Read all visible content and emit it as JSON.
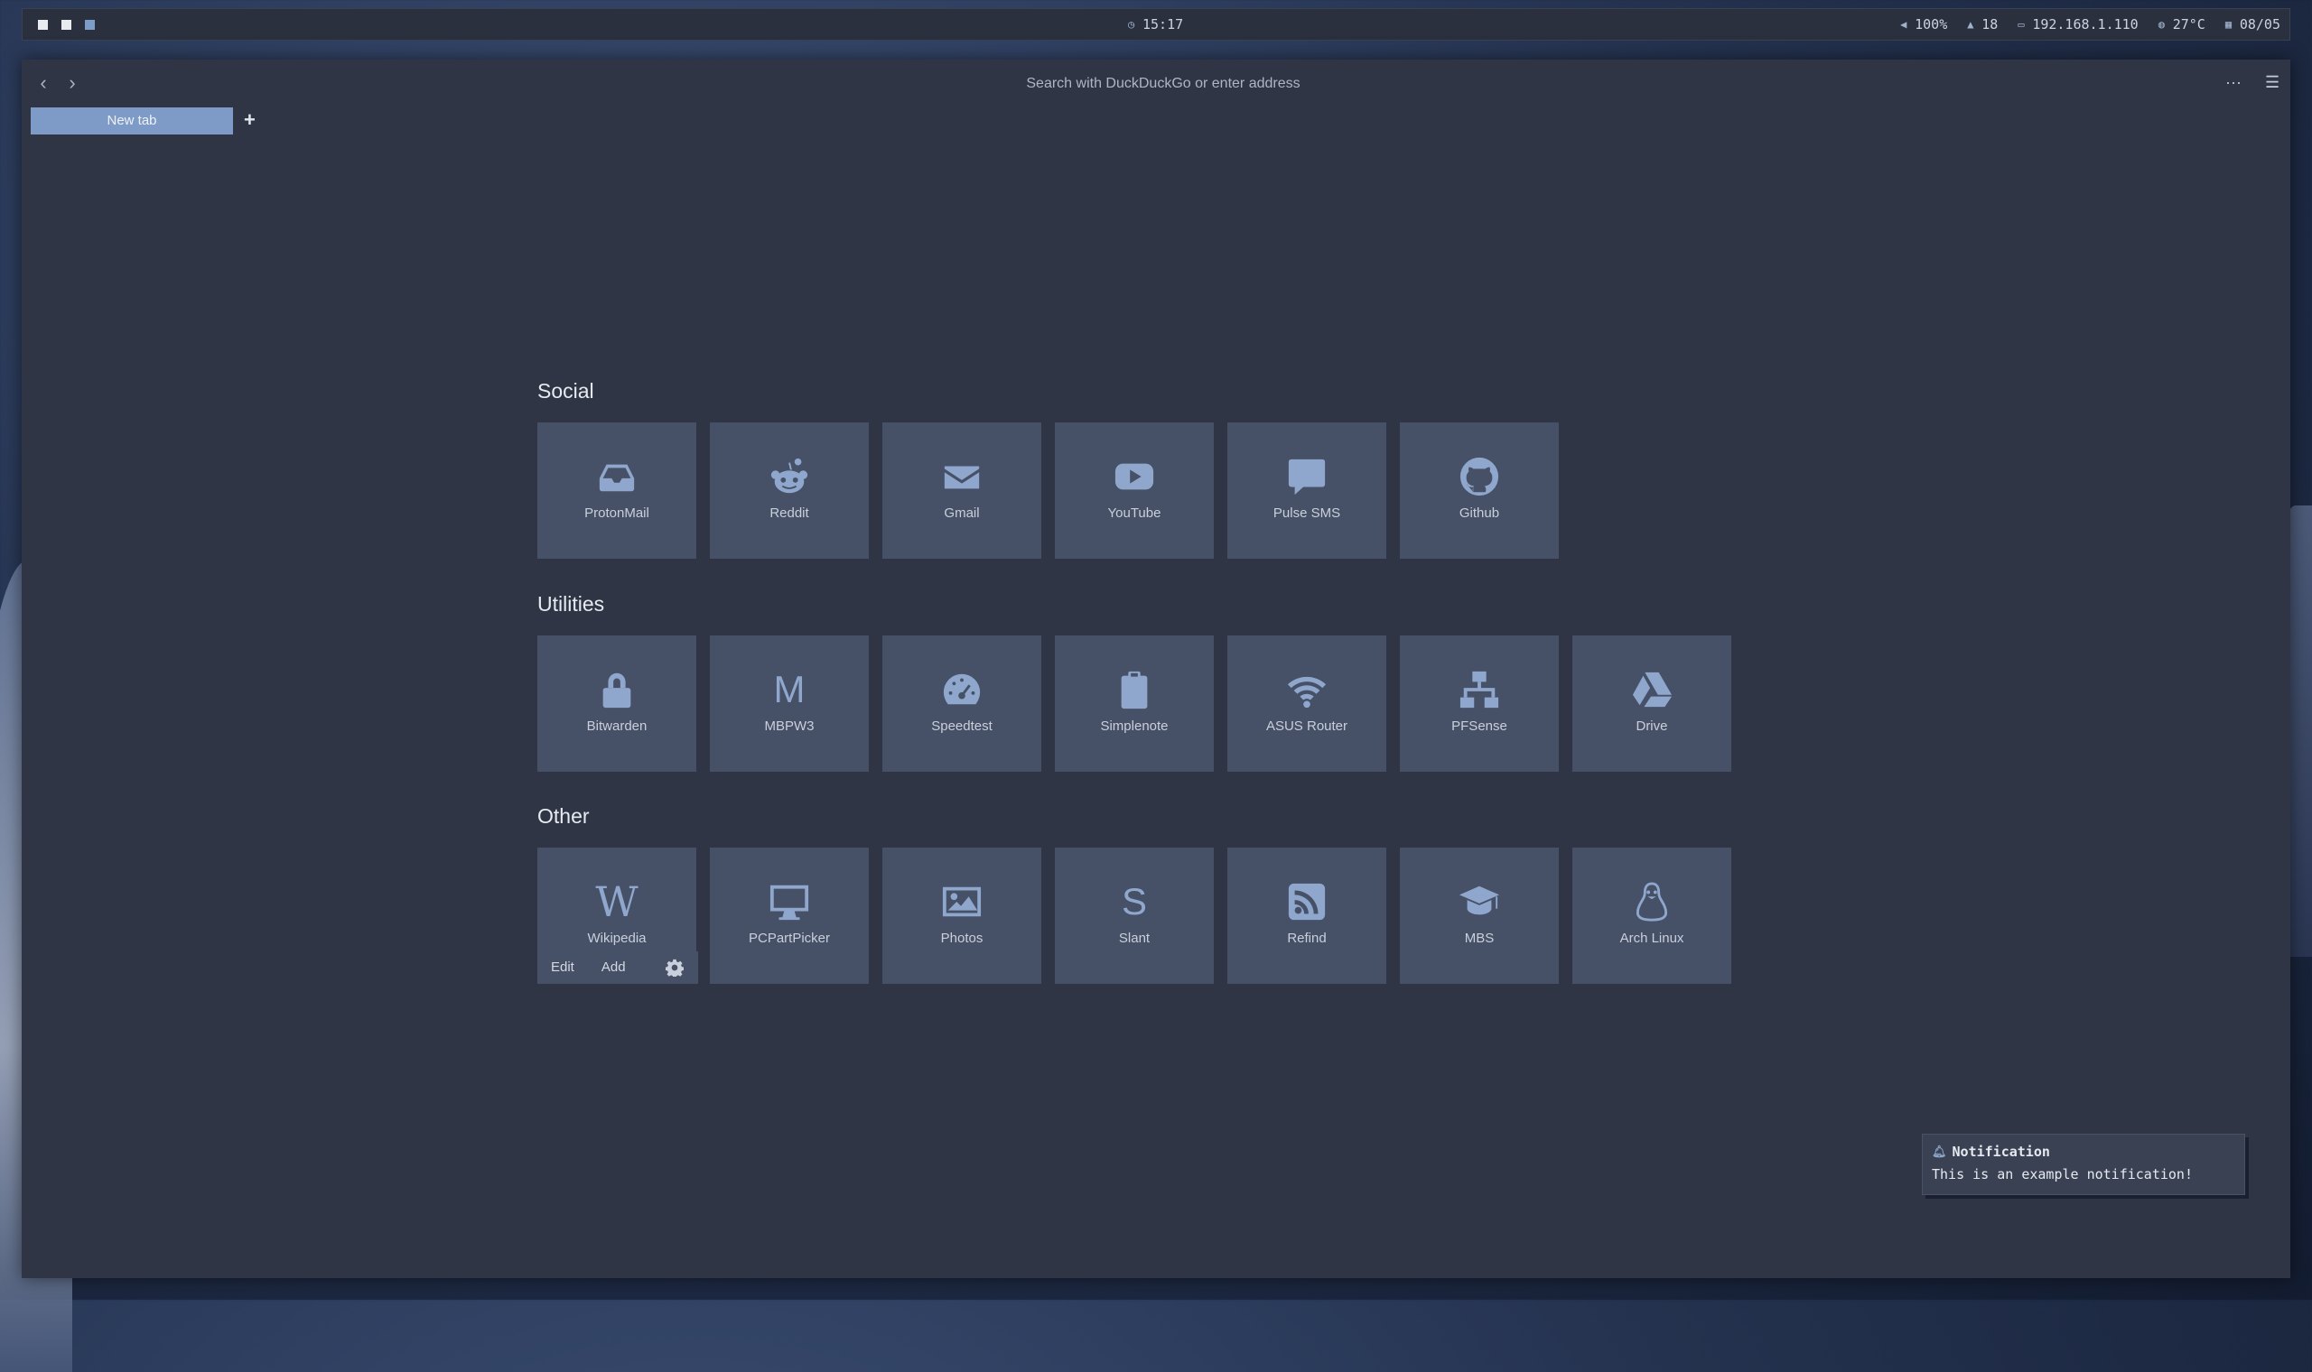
{
  "topbar": {
    "workspaces": [
      "1",
      "2",
      "3"
    ],
    "clock": "15:17",
    "volume": "100%",
    "updates": "18",
    "ip": "192.168.1.110",
    "temp": "27°C",
    "date": "08/05"
  },
  "browser": {
    "address_placeholder": "Search with DuckDuckGo or enter address",
    "tab_label": "New tab",
    "new_tab_symbol": "+"
  },
  "sections": [
    {
      "title": "Social",
      "items": [
        {
          "label": "ProtonMail",
          "icon": "inbox-icon"
        },
        {
          "label": "Reddit",
          "icon": "reddit-icon"
        },
        {
          "label": "Gmail",
          "icon": "envelope-icon"
        },
        {
          "label": "YouTube",
          "icon": "youtube-icon"
        },
        {
          "label": "Pulse SMS",
          "icon": "chat-bubble-icon"
        },
        {
          "label": "Github",
          "icon": "github-icon"
        }
      ]
    },
    {
      "title": "Utilities",
      "items": [
        {
          "label": "Bitwarden",
          "icon": "lock-icon"
        },
        {
          "label": "MBPW3",
          "icon": "letter-m-icon"
        },
        {
          "label": "Speedtest",
          "icon": "speedometer-icon"
        },
        {
          "label": "Simplenote",
          "icon": "clipboard-icon"
        },
        {
          "label": "ASUS Router",
          "icon": "wifi-icon"
        },
        {
          "label": "PFSense",
          "icon": "network-icon"
        },
        {
          "label": "Drive",
          "icon": "google-drive-icon"
        }
      ]
    },
    {
      "title": "Other",
      "items": [
        {
          "label": "Wikipedia",
          "icon": "wikipedia-icon"
        },
        {
          "label": "PCPartPicker",
          "icon": "desktop-icon"
        },
        {
          "label": "Photos",
          "icon": "image-icon"
        },
        {
          "label": "Slant",
          "icon": "letter-s-icon"
        },
        {
          "label": "Refind",
          "icon": "rss-icon"
        },
        {
          "label": "MBS",
          "icon": "graduation-cap-icon"
        },
        {
          "label": "Arch Linux",
          "icon": "linux-icon"
        }
      ]
    }
  ],
  "actions": {
    "edit": "Edit",
    "add": "Add"
  },
  "notification": {
    "title": "Notification",
    "message": "This is an example notification!"
  },
  "colors": {
    "accent": "#7d9bc6",
    "tile": "#465066",
    "icon": "#8fa7cc",
    "window": "#2f3544"
  }
}
